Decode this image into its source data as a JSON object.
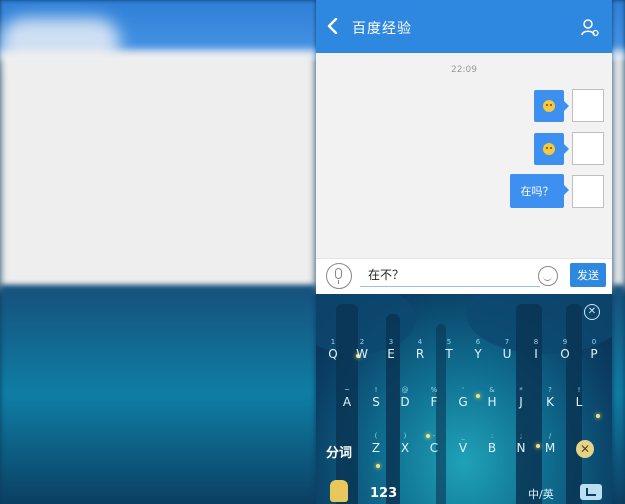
{
  "header": {
    "title": "百度经验"
  },
  "chat": {
    "timestamp": "22:09",
    "messages": [
      {
        "type": "emoji",
        "content": "emoji-icon"
      },
      {
        "type": "emoji",
        "content": "emoji-icon"
      },
      {
        "type": "text",
        "content": "在吗？"
      }
    ]
  },
  "input": {
    "value": "在不？",
    "send_label": "发送"
  },
  "keyboard": {
    "row1": [
      {
        "key": "Q",
        "hint": "1"
      },
      {
        "key": "W",
        "hint": "2"
      },
      {
        "key": "E",
        "hint": "3"
      },
      {
        "key": "R",
        "hint": "4"
      },
      {
        "key": "T",
        "hint": "5"
      },
      {
        "key": "Y",
        "hint": "6"
      },
      {
        "key": "U",
        "hint": "7"
      },
      {
        "key": "I",
        "hint": "8"
      },
      {
        "key": "O",
        "hint": "9"
      },
      {
        "key": "P",
        "hint": "0"
      }
    ],
    "row2": [
      {
        "key": "A",
        "hint": "~"
      },
      {
        "key": "S",
        "hint": "!"
      },
      {
        "key": "D",
        "hint": "@"
      },
      {
        "key": "F",
        "hint": "%"
      },
      {
        "key": "G",
        "hint": "'"
      },
      {
        "key": "H",
        "hint": "&"
      },
      {
        "key": "J",
        "hint": "*"
      },
      {
        "key": "K",
        "hint": "?"
      },
      {
        "key": "L",
        "hint": "!"
      }
    ],
    "row3": [
      {
        "key": "Z",
        "hint": "("
      },
      {
        "key": "X",
        "hint": ")"
      },
      {
        "key": "C",
        "hint": "-"
      },
      {
        "key": "V",
        "hint": "_"
      },
      {
        "key": "B",
        "hint": ":"
      },
      {
        "key": "N",
        "hint": ";"
      },
      {
        "key": "M",
        "hint": "/"
      }
    ],
    "segment_label": "分词",
    "numbers_label": "123",
    "lang_label": "中/英"
  },
  "colors": {
    "accent": "#2f88df",
    "bubble": "#3d8ff0"
  }
}
